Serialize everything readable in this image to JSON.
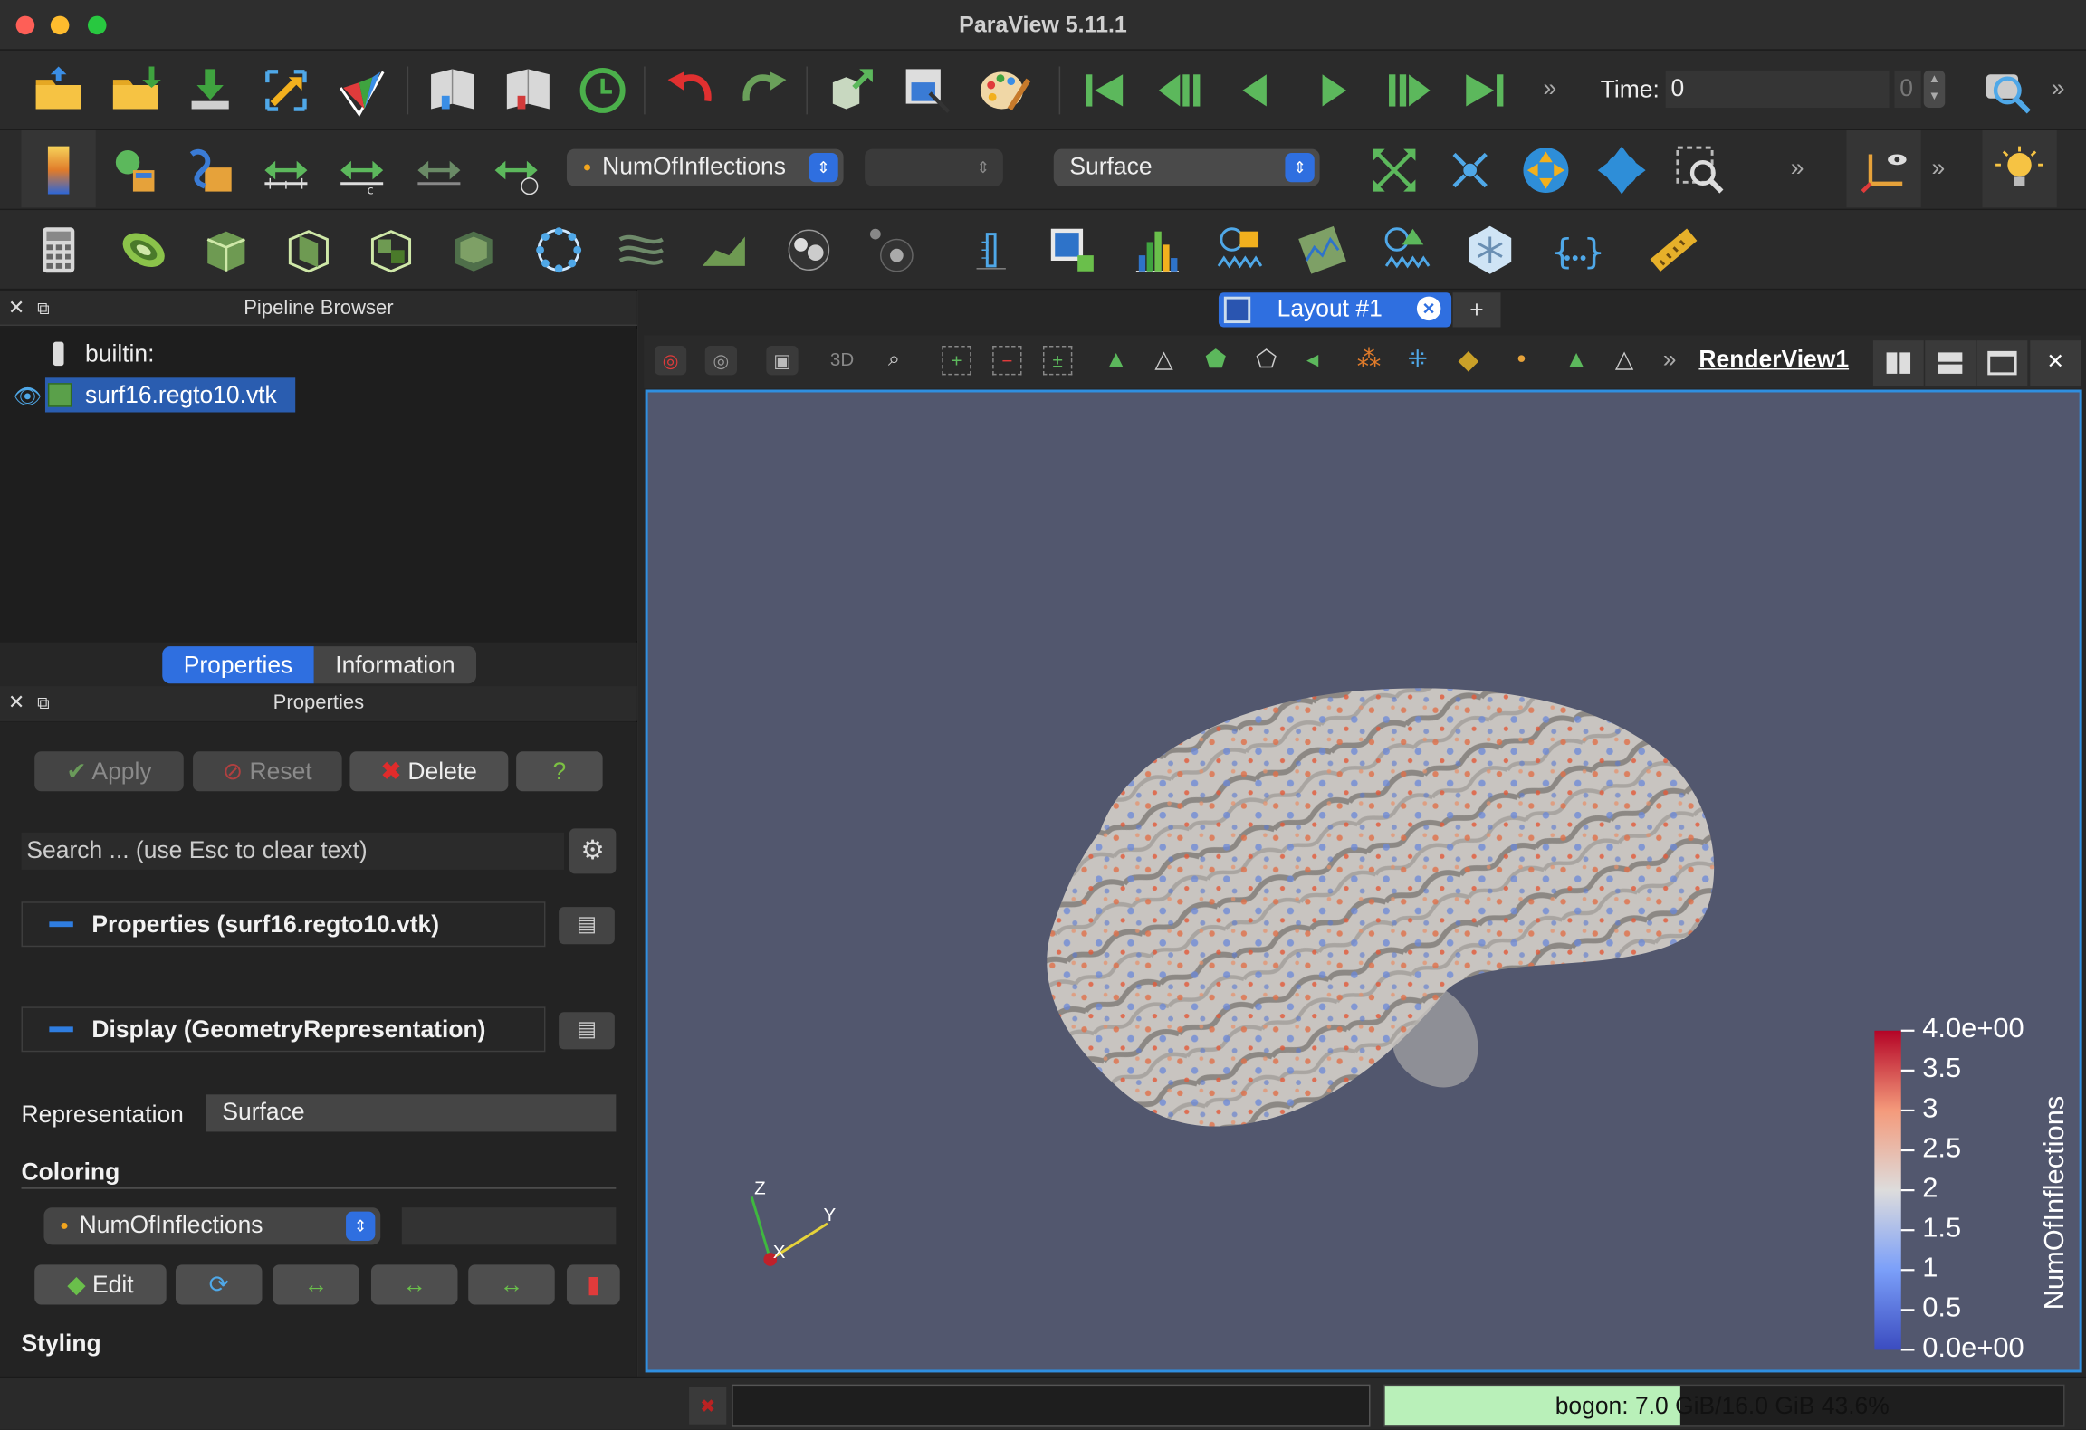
{
  "window": {
    "title": "ParaView 5.11.1"
  },
  "time": {
    "label": "Time:",
    "value": "0",
    "index": "0"
  },
  "toolbar2": {
    "color_array": "NumOfInflections",
    "component": "",
    "representation": "Surface"
  },
  "pipeline": {
    "title": "Pipeline Browser",
    "root": "builtin:",
    "item": "surf16.regto10.vtk"
  },
  "tabs": {
    "properties": "Properties",
    "information": "Information"
  },
  "properties": {
    "title": "Properties",
    "apply": "Apply",
    "reset": "Reset",
    "delete": "Delete",
    "help": "?",
    "search_placeholder": "Search ... (use Esc to clear text)",
    "section_props": "Properties (surf16.regto10.vtk)",
    "section_display": "Display (GeometryRepresentation)",
    "representation_label": "Representation",
    "representation_value": "Surface",
    "coloring_label": "Coloring",
    "coloring_value": "NumOfInflections",
    "edit": "Edit",
    "styling_label": "Styling"
  },
  "layout": {
    "tab": "Layout #1",
    "add": "+",
    "view_name": "RenderView1",
    "mode3d": "3D"
  },
  "scalar_bar": {
    "title": "NumOfInflections",
    "ticks": [
      "4.0e+00",
      "3.5",
      "3",
      "2.5",
      "2",
      "1.5",
      "1",
      "0.5",
      "0.0e+00"
    ],
    "range": [
      0,
      4
    ]
  },
  "axes": {
    "z": "Z",
    "y": "Y",
    "x": "X"
  },
  "status": {
    "memory": "bogon: 7.0 GiB/16.0 GiB 43.6%",
    "memory_fraction": 0.436
  },
  "colors": {
    "accent": "#2f7de0",
    "background_view": "#52576e",
    "selection": "#2a5db0"
  }
}
